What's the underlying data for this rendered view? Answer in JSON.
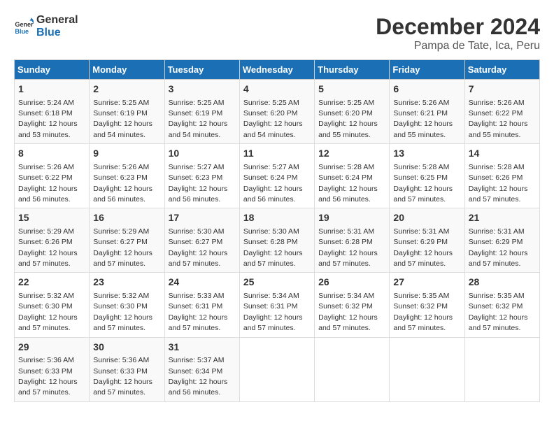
{
  "logo": {
    "line1": "General",
    "line2": "Blue"
  },
  "title": "December 2024",
  "location": "Pampa de Tate, Ica, Peru",
  "weekdays": [
    "Sunday",
    "Monday",
    "Tuesday",
    "Wednesday",
    "Thursday",
    "Friday",
    "Saturday"
  ],
  "weeks": [
    [
      {
        "day": "1",
        "sunrise": "5:24 AM",
        "sunset": "6:18 PM",
        "daylight": "12 hours and 53 minutes."
      },
      {
        "day": "2",
        "sunrise": "5:25 AM",
        "sunset": "6:19 PM",
        "daylight": "12 hours and 54 minutes."
      },
      {
        "day": "3",
        "sunrise": "5:25 AM",
        "sunset": "6:19 PM",
        "daylight": "12 hours and 54 minutes."
      },
      {
        "day": "4",
        "sunrise": "5:25 AM",
        "sunset": "6:20 PM",
        "daylight": "12 hours and 54 minutes."
      },
      {
        "day": "5",
        "sunrise": "5:25 AM",
        "sunset": "6:20 PM",
        "daylight": "12 hours and 55 minutes."
      },
      {
        "day": "6",
        "sunrise": "5:26 AM",
        "sunset": "6:21 PM",
        "daylight": "12 hours and 55 minutes."
      },
      {
        "day": "7",
        "sunrise": "5:26 AM",
        "sunset": "6:22 PM",
        "daylight": "12 hours and 55 minutes."
      }
    ],
    [
      {
        "day": "8",
        "sunrise": "5:26 AM",
        "sunset": "6:22 PM",
        "daylight": "12 hours and 56 minutes."
      },
      {
        "day": "9",
        "sunrise": "5:26 AM",
        "sunset": "6:23 PM",
        "daylight": "12 hours and 56 minutes."
      },
      {
        "day": "10",
        "sunrise": "5:27 AM",
        "sunset": "6:23 PM",
        "daylight": "12 hours and 56 minutes."
      },
      {
        "day": "11",
        "sunrise": "5:27 AM",
        "sunset": "6:24 PM",
        "daylight": "12 hours and 56 minutes."
      },
      {
        "day": "12",
        "sunrise": "5:28 AM",
        "sunset": "6:24 PM",
        "daylight": "12 hours and 56 minutes."
      },
      {
        "day": "13",
        "sunrise": "5:28 AM",
        "sunset": "6:25 PM",
        "daylight": "12 hours and 57 minutes."
      },
      {
        "day": "14",
        "sunrise": "5:28 AM",
        "sunset": "6:26 PM",
        "daylight": "12 hours and 57 minutes."
      }
    ],
    [
      {
        "day": "15",
        "sunrise": "5:29 AM",
        "sunset": "6:26 PM",
        "daylight": "12 hours and 57 minutes."
      },
      {
        "day": "16",
        "sunrise": "5:29 AM",
        "sunset": "6:27 PM",
        "daylight": "12 hours and 57 minutes."
      },
      {
        "day": "17",
        "sunrise": "5:30 AM",
        "sunset": "6:27 PM",
        "daylight": "12 hours and 57 minutes."
      },
      {
        "day": "18",
        "sunrise": "5:30 AM",
        "sunset": "6:28 PM",
        "daylight": "12 hours and 57 minutes."
      },
      {
        "day": "19",
        "sunrise": "5:31 AM",
        "sunset": "6:28 PM",
        "daylight": "12 hours and 57 minutes."
      },
      {
        "day": "20",
        "sunrise": "5:31 AM",
        "sunset": "6:29 PM",
        "daylight": "12 hours and 57 minutes."
      },
      {
        "day": "21",
        "sunrise": "5:31 AM",
        "sunset": "6:29 PM",
        "daylight": "12 hours and 57 minutes."
      }
    ],
    [
      {
        "day": "22",
        "sunrise": "5:32 AM",
        "sunset": "6:30 PM",
        "daylight": "12 hours and 57 minutes."
      },
      {
        "day": "23",
        "sunrise": "5:32 AM",
        "sunset": "6:30 PM",
        "daylight": "12 hours and 57 minutes."
      },
      {
        "day": "24",
        "sunrise": "5:33 AM",
        "sunset": "6:31 PM",
        "daylight": "12 hours and 57 minutes."
      },
      {
        "day": "25",
        "sunrise": "5:34 AM",
        "sunset": "6:31 PM",
        "daylight": "12 hours and 57 minutes."
      },
      {
        "day": "26",
        "sunrise": "5:34 AM",
        "sunset": "6:32 PM",
        "daylight": "12 hours and 57 minutes."
      },
      {
        "day": "27",
        "sunrise": "5:35 AM",
        "sunset": "6:32 PM",
        "daylight": "12 hours and 57 minutes."
      },
      {
        "day": "28",
        "sunrise": "5:35 AM",
        "sunset": "6:32 PM",
        "daylight": "12 hours and 57 minutes."
      }
    ],
    [
      {
        "day": "29",
        "sunrise": "5:36 AM",
        "sunset": "6:33 PM",
        "daylight": "12 hours and 57 minutes."
      },
      {
        "day": "30",
        "sunrise": "5:36 AM",
        "sunset": "6:33 PM",
        "daylight": "12 hours and 57 minutes."
      },
      {
        "day": "31",
        "sunrise": "5:37 AM",
        "sunset": "6:34 PM",
        "daylight": "12 hours and 56 minutes."
      },
      null,
      null,
      null,
      null
    ]
  ],
  "labels": {
    "sunrise": "Sunrise:",
    "sunset": "Sunset:",
    "daylight": "Daylight:"
  }
}
